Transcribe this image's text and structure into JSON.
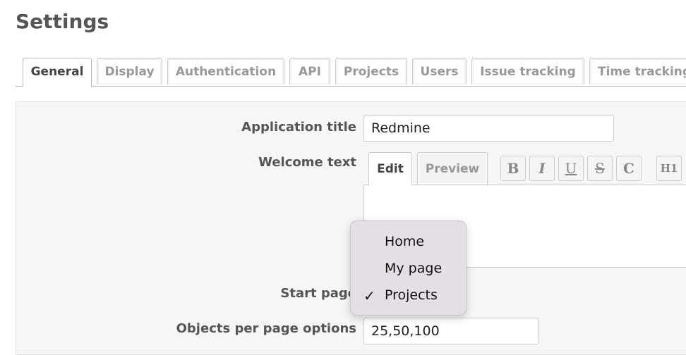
{
  "page": {
    "title": "Settings"
  },
  "tabs": [
    {
      "label": "General",
      "active": true
    },
    {
      "label": "Display",
      "active": false
    },
    {
      "label": "Authentication",
      "active": false
    },
    {
      "label": "API",
      "active": false
    },
    {
      "label": "Projects",
      "active": false
    },
    {
      "label": "Users",
      "active": false
    },
    {
      "label": "Issue tracking",
      "active": false
    },
    {
      "label": "Time tracking",
      "active": false
    }
  ],
  "form": {
    "app_title_label": "Application title",
    "app_title_value": "Redmine",
    "welcome_label": "Welcome text",
    "start_page_label": "Start page",
    "per_page_label": "Objects per page options",
    "per_page_value": "25,50,100"
  },
  "editor": {
    "tabs": [
      "Edit",
      "Preview"
    ],
    "toolbar": [
      "B",
      "I",
      "U",
      "S",
      "C",
      "H1"
    ]
  },
  "start_page_dropdown": {
    "options": [
      "Home",
      "My page",
      "Projects"
    ],
    "selected": "Projects",
    "check_glyph": "✓"
  }
}
